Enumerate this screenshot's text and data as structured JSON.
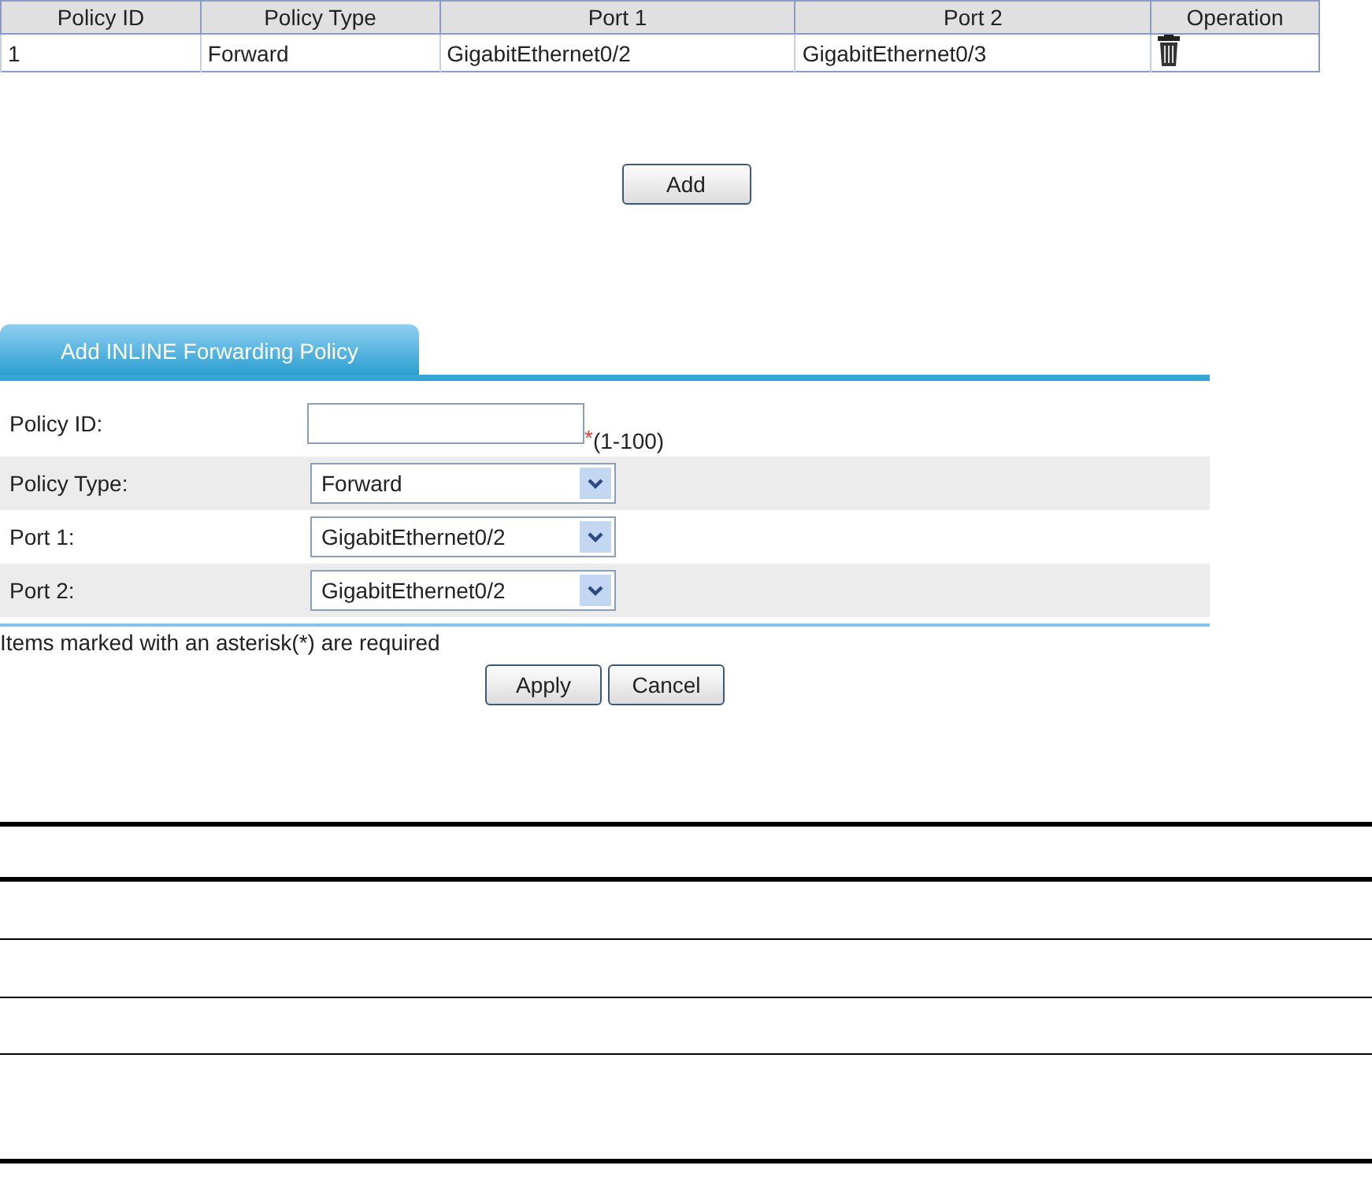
{
  "policy_table": {
    "columns": [
      "Policy ID",
      "Policy Type",
      "Port 1",
      "Port 2",
      "Operation"
    ],
    "rows": [
      {
        "policy_id": "1",
        "policy_type": "Forward",
        "port_1": "GigabitEthernet0/2",
        "port_2": "GigabitEthernet0/3"
      }
    ]
  },
  "add_button": "Add",
  "form": {
    "tab": "Add INLINE Forwarding Policy",
    "fields": [
      {
        "kind": "text",
        "label": "Policy ID:",
        "required_mark": "*",
        "hint": "(1-100)"
      },
      {
        "kind": "select",
        "label": "Policy Type:",
        "value": "Forward"
      },
      {
        "kind": "select",
        "label": "Port 1:",
        "value": "GigabitEthernet0/2"
      },
      {
        "kind": "select",
        "label": "Port 2:",
        "value": "GigabitEthernet0/2"
      }
    ],
    "note": "Items marked with an asterisk(*) are required",
    "buttons": [
      "Apply",
      "Cancel"
    ]
  }
}
